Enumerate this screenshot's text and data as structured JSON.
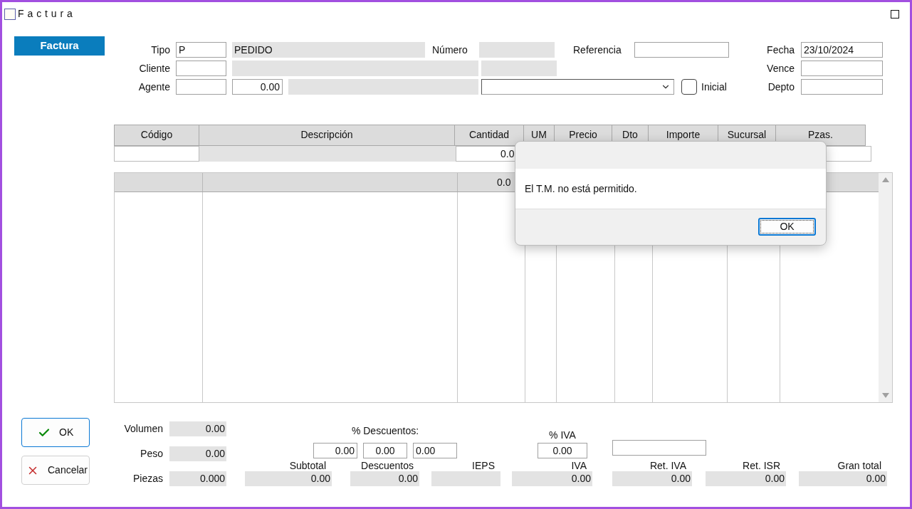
{
  "window": {
    "title": "Factura"
  },
  "tab": {
    "label": "Factura",
    "selected": true
  },
  "header": {
    "tipo": {
      "label": "Tipo",
      "code": "P",
      "name": "PEDIDO"
    },
    "numero": {
      "label": "Número"
    },
    "referencia": {
      "label": "Referencia"
    },
    "fecha": {
      "label": "Fecha",
      "value": "23/10/2024"
    },
    "cliente": {
      "label": "Cliente"
    },
    "vence": {
      "label": "Vence"
    },
    "agente": {
      "label": "Agente",
      "amount": "0.00"
    },
    "inicial": {
      "label": "Inicial",
      "checked": false
    },
    "depto": {
      "label": "Depto"
    }
  },
  "grid": {
    "columns": [
      "Código",
      "Descripción",
      "Cantidad",
      "UM",
      "Precio",
      "Dto",
      "Importe",
      "Sucursal",
      "Pzas."
    ],
    "entry_row": {
      "cantidad": "0.0"
    },
    "totals_row": {
      "cantidad": "0.0"
    }
  },
  "dialog": {
    "message": "El T.M. no está permitido.",
    "button": "OK"
  },
  "actions": [
    {
      "kind": "ok",
      "label": "OK"
    },
    {
      "kind": "cancel",
      "label": "Cancelar"
    }
  ],
  "measures": [
    {
      "label": "Volumen",
      "value": "0.00"
    },
    {
      "label": "Peso",
      "value": "0.00"
    },
    {
      "label": "Piezas",
      "value": "0.000"
    }
  ],
  "discounts": {
    "label": "% Descuentos:",
    "values": [
      "0.00",
      "0.00",
      "0.00"
    ]
  },
  "iva": {
    "label": "% IVA",
    "value": "0.00"
  },
  "totals": [
    {
      "label": "Subtotal",
      "value": "0.00"
    },
    {
      "label": "Descuentos",
      "value": "0.00"
    },
    {
      "label": "IEPS"
    },
    {
      "label": "IVA",
      "value": "0.00"
    },
    {
      "label": "Ret. IVA",
      "value": "0.00"
    },
    {
      "label": "Ret. ISR",
      "value": "0.00"
    },
    {
      "label": "Gran total",
      "value": "0.00"
    }
  ]
}
